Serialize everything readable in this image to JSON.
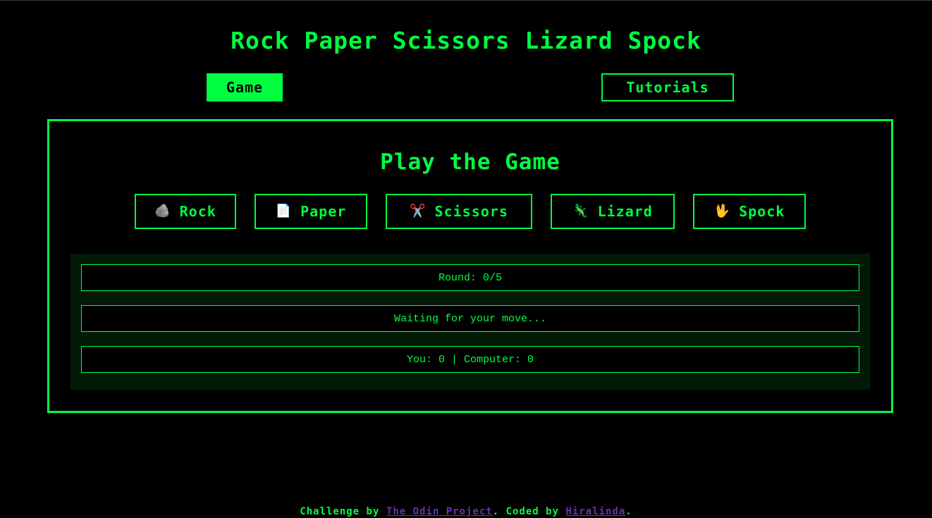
{
  "header": {
    "title": "Rock Paper Scissors Lizard Spock"
  },
  "nav": {
    "game_label": "Game",
    "tutorials_label": "Tutorials",
    "active": "Game"
  },
  "game": {
    "heading": "Play the Game",
    "choices": [
      {
        "icon": "rock-icon",
        "glyph": "🪨",
        "label": "Rock"
      },
      {
        "icon": "paper-icon",
        "glyph": "📄",
        "label": "Paper"
      },
      {
        "icon": "scissors-icon",
        "glyph": "✂️",
        "label": "Scissors"
      },
      {
        "icon": "lizard-icon",
        "glyph": "🦎",
        "label": "Lizard"
      },
      {
        "icon": "vulcan-salute-icon",
        "glyph": "🖖",
        "label": "Spock"
      }
    ],
    "round_text": "Round: 0/5",
    "status_text": "Waiting for your move...",
    "score_text": "You: 0 | Computer: 0"
  },
  "footer": {
    "prefix": "Challenge by ",
    "odin_link": "The Odin Project",
    "middle": ". Coded by ",
    "author_link": "Hiralinda",
    "suffix": "."
  },
  "colors": {
    "accent": "#00ff41",
    "background": "#000000",
    "results_bg": "#031a07",
    "link": "#6a2fb6"
  }
}
